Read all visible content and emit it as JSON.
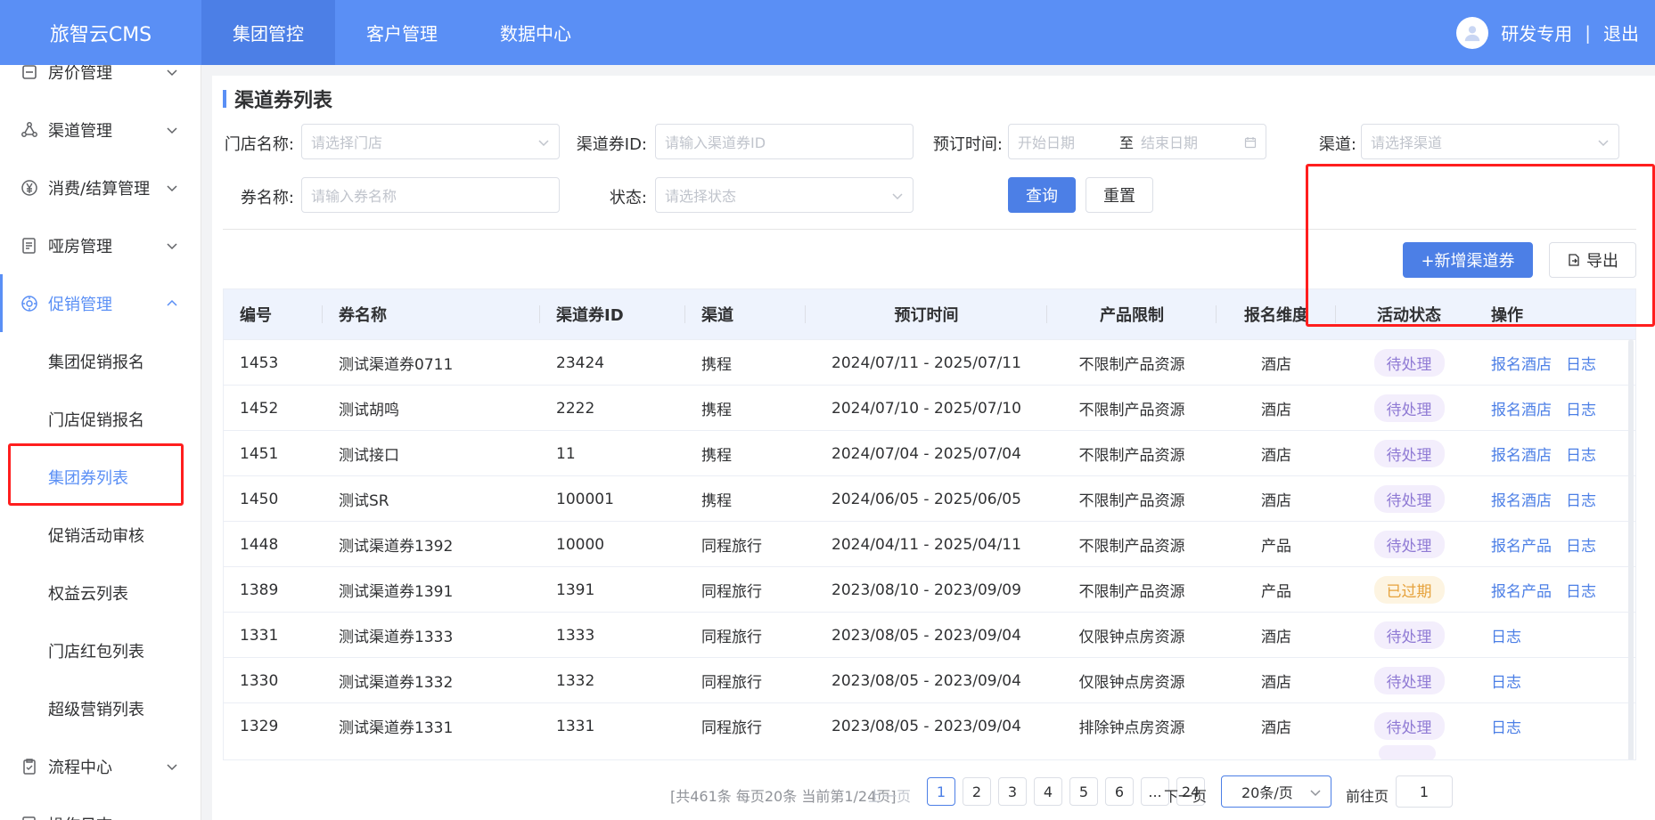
{
  "header": {
    "logo": "旅智云CMS",
    "nav": [
      "集团管控",
      "客户管理",
      "数据中心"
    ],
    "user_name": "研发专用",
    "divider": "|",
    "logout": "退出"
  },
  "sidebar": {
    "top_partial": "房价管理",
    "items": [
      {
        "label": "渠道管理",
        "icon": "share-icon"
      },
      {
        "label": "消费/结算管理",
        "icon": "yen-icon"
      },
      {
        "label": "哑房管理",
        "icon": "document-icon"
      },
      {
        "label": "促销管理",
        "icon": "promotion-icon"
      }
    ],
    "sub_items": [
      "集团促销报名",
      "门店促销报名",
      "集团券列表",
      "促销活动审核",
      "权益云列表",
      "门店红包列表",
      "超级营销列表"
    ],
    "bottom_items": [
      {
        "label": "流程中心",
        "icon": "flow-icon"
      },
      {
        "label": "操作日志",
        "icon": "log-icon"
      }
    ]
  },
  "page": {
    "title": "渠道券列表"
  },
  "filters": {
    "store_label": "门店名称:",
    "store_placeholder": "请选择门店",
    "coupon_id_label": "渠道券ID:",
    "coupon_id_placeholder": "请输入渠道券ID",
    "booking_label": "预订时间:",
    "start_placeholder": "开始日期",
    "range_sep": "至",
    "end_placeholder": "结束日期",
    "channel_label": "渠道:",
    "channel_placeholder": "请选择渠道",
    "name_label": "券名称:",
    "name_placeholder": "请输入券名称",
    "status_label": "状态:",
    "status_placeholder": "请选择状态",
    "query_btn": "查询",
    "reset_btn": "重置"
  },
  "actions": {
    "add_btn": "+新增渠道券",
    "export_btn": "导出"
  },
  "table": {
    "columns": [
      "编号",
      "券名称",
      "渠道券ID",
      "渠道",
      "预订时间",
      "产品限制",
      "报名维度",
      "活动状态",
      "操作"
    ],
    "rows": [
      {
        "id": "1453",
        "name": "测试渠道券0711",
        "cid": "23424",
        "channel": "携程",
        "time": "2024/07/11 - 2025/07/11",
        "limit": "不限制产品资源",
        "dim": "酒店",
        "status": "待处理",
        "status_type": "pending",
        "ops": [
          "报名酒店",
          "日志"
        ]
      },
      {
        "id": "1452",
        "name": "测试胡鸣",
        "cid": "2222",
        "channel": "携程",
        "time": "2024/07/10 - 2025/07/10",
        "limit": "不限制产品资源",
        "dim": "酒店",
        "status": "待处理",
        "status_type": "pending",
        "ops": [
          "报名酒店",
          "日志"
        ]
      },
      {
        "id": "1451",
        "name": "测试接口",
        "cid": "11",
        "channel": "携程",
        "time": "2024/07/04 - 2025/07/04",
        "limit": "不限制产品资源",
        "dim": "酒店",
        "status": "待处理",
        "status_type": "pending",
        "ops": [
          "报名酒店",
          "日志"
        ]
      },
      {
        "id": "1450",
        "name": "测试SR",
        "cid": "100001",
        "channel": "携程",
        "time": "2024/06/05 - 2025/06/05",
        "limit": "不限制产品资源",
        "dim": "酒店",
        "status": "待处理",
        "status_type": "pending",
        "ops": [
          "报名酒店",
          "日志"
        ]
      },
      {
        "id": "1448",
        "name": "测试渠道券1392",
        "cid": "10000",
        "channel": "同程旅行",
        "time": "2024/04/11 - 2025/04/11",
        "limit": "不限制产品资源",
        "dim": "产品",
        "status": "待处理",
        "status_type": "pending",
        "ops": [
          "报名产品",
          "日志"
        ]
      },
      {
        "id": "1389",
        "name": "测试渠道券1391",
        "cid": "1391",
        "channel": "同程旅行",
        "time": "2023/08/10 - 2023/09/09",
        "limit": "不限制产品资源",
        "dim": "产品",
        "status": "已过期",
        "status_type": "expired",
        "ops": [
          "报名产品",
          "日志"
        ]
      },
      {
        "id": "1331",
        "name": "测试渠道券1333",
        "cid": "1333",
        "channel": "同程旅行",
        "time": "2023/08/05 - 2023/09/04",
        "limit": "仅限钟点房资源",
        "dim": "酒店",
        "status": "待处理",
        "status_type": "pending",
        "ops": [
          "日志"
        ]
      },
      {
        "id": "1330",
        "name": "测试渠道券1332",
        "cid": "1332",
        "channel": "同程旅行",
        "time": "2023/08/05 - 2023/09/04",
        "limit": "仅限钟点房资源",
        "dim": "酒店",
        "status": "待处理",
        "status_type": "pending",
        "ops": [
          "日志"
        ]
      },
      {
        "id": "1329",
        "name": "测试渠道券1331",
        "cid": "1331",
        "channel": "同程旅行",
        "time": "2023/08/05 - 2023/09/04",
        "limit": "排除钟点房资源",
        "dim": "酒店",
        "status": "待处理",
        "status_type": "pending",
        "ops": [
          "日志"
        ]
      }
    ]
  },
  "pagination": {
    "summary": "[共461条 每页20条 当前第1/24页]",
    "prev": "上一页",
    "pages": [
      "1",
      "2",
      "3",
      "4",
      "5",
      "6",
      "...",
      "24"
    ],
    "current": "1",
    "next": "下一页",
    "page_size": "20条/页",
    "goto_label": "前往页",
    "goto_value": "1"
  },
  "colors": {
    "primary": "#5a8ff5",
    "highlight": "#ff1e1e"
  }
}
